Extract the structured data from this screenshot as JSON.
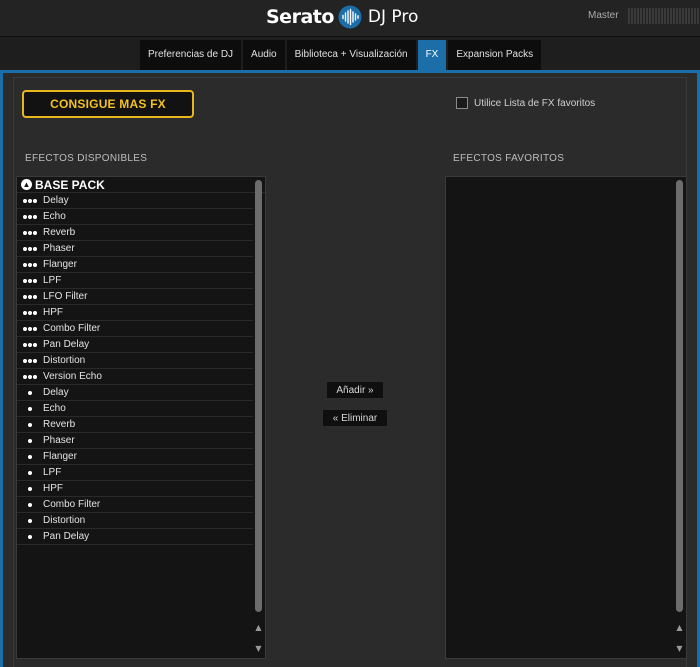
{
  "header": {
    "logo_word": "Serato",
    "logo_sub": "DJ Pro",
    "master_label": "Master"
  },
  "tabs": [
    {
      "label": "Preferencias de DJ",
      "active": false
    },
    {
      "label": "Audio",
      "active": false
    },
    {
      "label": "Biblioteca + Visualización",
      "active": false
    },
    {
      "label": "FX",
      "active": true
    },
    {
      "label": "Expansion Packs",
      "active": false
    }
  ],
  "fx": {
    "promo_button": "CONSIGUE MAS FX",
    "favorites_toggle_label": "Utilice Lista de FX favoritos",
    "favorites_toggle_checked": false,
    "available_title": "EFECTOS DISPONIBLES",
    "favorites_title": "EFECTOS FAVORITOS",
    "add_button": "Añadir »",
    "remove_button": "« Eliminar",
    "pack_name": "BASE PACK",
    "multi_fx": [
      "Delay",
      "Echo",
      "Reverb",
      "Phaser",
      "Flanger",
      "LPF",
      "LFO Filter",
      "HPF",
      "Combo Filter",
      "Pan Delay",
      "Distortion",
      "Version Echo"
    ],
    "single_fx": [
      "Delay",
      "Echo",
      "Reverb",
      "Phaser",
      "Flanger",
      "LPF",
      "HPF",
      "Combo Filter",
      "Distortion",
      "Pan Delay"
    ],
    "favorites": []
  },
  "icons": {
    "pack": "base-pack-icon",
    "multi": "three-dot-multi-fx-icon",
    "single": "single-dot-fx-icon",
    "scroll_up": "scroll-up-arrow-icon",
    "scroll_down": "scroll-down-arrow-icon"
  },
  "colors": {
    "accent": "#1c6ea8",
    "promo": "#f3c21f",
    "background": "#2b2b2b"
  }
}
